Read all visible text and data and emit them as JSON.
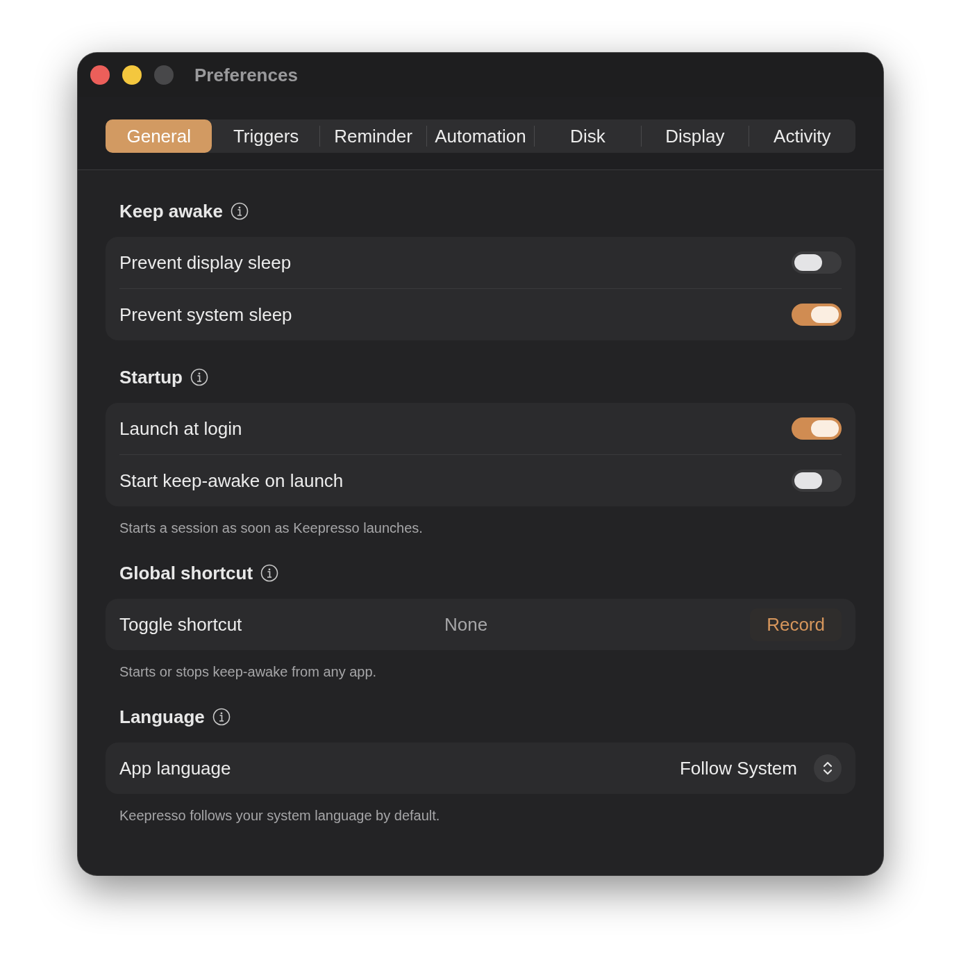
{
  "window": {
    "title": "Preferences"
  },
  "tabs": [
    {
      "label": "General",
      "selected": true
    },
    {
      "label": "Triggers",
      "selected": false
    },
    {
      "label": "Reminder",
      "selected": false
    },
    {
      "label": "Automation",
      "selected": false
    },
    {
      "label": "Disk",
      "selected": false
    },
    {
      "label": "Display",
      "selected": false
    },
    {
      "label": "Activity",
      "selected": false
    }
  ],
  "sections": [
    {
      "title": "Keep awake",
      "rows": [
        {
          "kind": "toggle",
          "label": "Prevent display sleep",
          "on": false
        },
        {
          "kind": "toggle",
          "label": "Prevent system sleep",
          "on": true
        }
      ]
    },
    {
      "title": "Startup",
      "rows": [
        {
          "kind": "toggle",
          "label": "Launch at login",
          "on": true
        },
        {
          "kind": "toggle",
          "label": "Start keep-awake on launch",
          "on": false
        }
      ],
      "caption": "Starts a session as soon as Keepresso launches."
    },
    {
      "title": "Global shortcut",
      "rows": [
        {
          "kind": "shortcut",
          "label": "Toggle shortcut",
          "value": "None",
          "button": "Record"
        }
      ],
      "caption": "Starts or stops keep-awake from any app."
    },
    {
      "title": "Language",
      "rows": [
        {
          "kind": "select",
          "label": "App language",
          "value": "Follow System"
        }
      ],
      "caption": "Keepresso follows your system language by default."
    }
  ]
}
